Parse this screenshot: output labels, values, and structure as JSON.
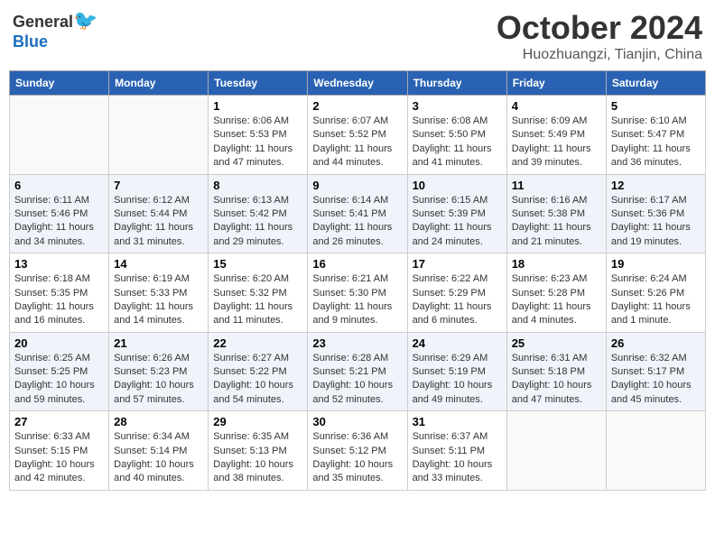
{
  "header": {
    "logo_general": "General",
    "logo_blue": "Blue",
    "month": "October 2024",
    "location": "Huozhuangzi, Tianjin, China"
  },
  "days_of_week": [
    "Sunday",
    "Monday",
    "Tuesday",
    "Wednesday",
    "Thursday",
    "Friday",
    "Saturday"
  ],
  "weeks": [
    [
      {
        "day": "",
        "info": ""
      },
      {
        "day": "",
        "info": ""
      },
      {
        "day": "1",
        "info": "Sunrise: 6:06 AM\nSunset: 5:53 PM\nDaylight: 11 hours and 47 minutes."
      },
      {
        "day": "2",
        "info": "Sunrise: 6:07 AM\nSunset: 5:52 PM\nDaylight: 11 hours and 44 minutes."
      },
      {
        "day": "3",
        "info": "Sunrise: 6:08 AM\nSunset: 5:50 PM\nDaylight: 11 hours and 41 minutes."
      },
      {
        "day": "4",
        "info": "Sunrise: 6:09 AM\nSunset: 5:49 PM\nDaylight: 11 hours and 39 minutes."
      },
      {
        "day": "5",
        "info": "Sunrise: 6:10 AM\nSunset: 5:47 PM\nDaylight: 11 hours and 36 minutes."
      }
    ],
    [
      {
        "day": "6",
        "info": "Sunrise: 6:11 AM\nSunset: 5:46 PM\nDaylight: 11 hours and 34 minutes."
      },
      {
        "day": "7",
        "info": "Sunrise: 6:12 AM\nSunset: 5:44 PM\nDaylight: 11 hours and 31 minutes."
      },
      {
        "day": "8",
        "info": "Sunrise: 6:13 AM\nSunset: 5:42 PM\nDaylight: 11 hours and 29 minutes."
      },
      {
        "day": "9",
        "info": "Sunrise: 6:14 AM\nSunset: 5:41 PM\nDaylight: 11 hours and 26 minutes."
      },
      {
        "day": "10",
        "info": "Sunrise: 6:15 AM\nSunset: 5:39 PM\nDaylight: 11 hours and 24 minutes."
      },
      {
        "day": "11",
        "info": "Sunrise: 6:16 AM\nSunset: 5:38 PM\nDaylight: 11 hours and 21 minutes."
      },
      {
        "day": "12",
        "info": "Sunrise: 6:17 AM\nSunset: 5:36 PM\nDaylight: 11 hours and 19 minutes."
      }
    ],
    [
      {
        "day": "13",
        "info": "Sunrise: 6:18 AM\nSunset: 5:35 PM\nDaylight: 11 hours and 16 minutes."
      },
      {
        "day": "14",
        "info": "Sunrise: 6:19 AM\nSunset: 5:33 PM\nDaylight: 11 hours and 14 minutes."
      },
      {
        "day": "15",
        "info": "Sunrise: 6:20 AM\nSunset: 5:32 PM\nDaylight: 11 hours and 11 minutes."
      },
      {
        "day": "16",
        "info": "Sunrise: 6:21 AM\nSunset: 5:30 PM\nDaylight: 11 hours and 9 minutes."
      },
      {
        "day": "17",
        "info": "Sunrise: 6:22 AM\nSunset: 5:29 PM\nDaylight: 11 hours and 6 minutes."
      },
      {
        "day": "18",
        "info": "Sunrise: 6:23 AM\nSunset: 5:28 PM\nDaylight: 11 hours and 4 minutes."
      },
      {
        "day": "19",
        "info": "Sunrise: 6:24 AM\nSunset: 5:26 PM\nDaylight: 11 hours and 1 minute."
      }
    ],
    [
      {
        "day": "20",
        "info": "Sunrise: 6:25 AM\nSunset: 5:25 PM\nDaylight: 10 hours and 59 minutes."
      },
      {
        "day": "21",
        "info": "Sunrise: 6:26 AM\nSunset: 5:23 PM\nDaylight: 10 hours and 57 minutes."
      },
      {
        "day": "22",
        "info": "Sunrise: 6:27 AM\nSunset: 5:22 PM\nDaylight: 10 hours and 54 minutes."
      },
      {
        "day": "23",
        "info": "Sunrise: 6:28 AM\nSunset: 5:21 PM\nDaylight: 10 hours and 52 minutes."
      },
      {
        "day": "24",
        "info": "Sunrise: 6:29 AM\nSunset: 5:19 PM\nDaylight: 10 hours and 49 minutes."
      },
      {
        "day": "25",
        "info": "Sunrise: 6:31 AM\nSunset: 5:18 PM\nDaylight: 10 hours and 47 minutes."
      },
      {
        "day": "26",
        "info": "Sunrise: 6:32 AM\nSunset: 5:17 PM\nDaylight: 10 hours and 45 minutes."
      }
    ],
    [
      {
        "day": "27",
        "info": "Sunrise: 6:33 AM\nSunset: 5:15 PM\nDaylight: 10 hours and 42 minutes."
      },
      {
        "day": "28",
        "info": "Sunrise: 6:34 AM\nSunset: 5:14 PM\nDaylight: 10 hours and 40 minutes."
      },
      {
        "day": "29",
        "info": "Sunrise: 6:35 AM\nSunset: 5:13 PM\nDaylight: 10 hours and 38 minutes."
      },
      {
        "day": "30",
        "info": "Sunrise: 6:36 AM\nSunset: 5:12 PM\nDaylight: 10 hours and 35 minutes."
      },
      {
        "day": "31",
        "info": "Sunrise: 6:37 AM\nSunset: 5:11 PM\nDaylight: 10 hours and 33 minutes."
      },
      {
        "day": "",
        "info": ""
      },
      {
        "day": "",
        "info": ""
      }
    ]
  ]
}
